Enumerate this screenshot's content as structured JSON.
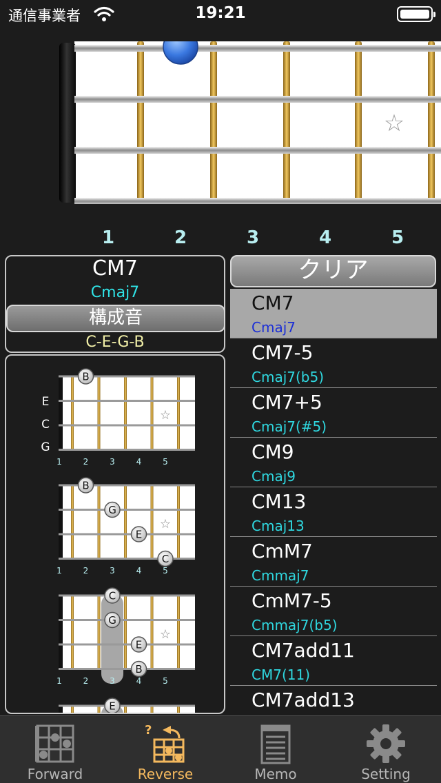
{
  "status": {
    "carrier": "通信事業者",
    "time": "19:21"
  },
  "fretboard": {
    "fret_numbers": [
      "1",
      "2",
      "3",
      "4",
      "5"
    ],
    "star_glyph": "☆"
  },
  "info": {
    "name": "CM7",
    "alt": "Cmaj7",
    "button_label": "構成音",
    "notes": "C-E-G-B"
  },
  "clear_label": "クリア",
  "diagrams": {
    "string_labels": [
      "E",
      "C",
      "G"
    ],
    "fret_numbers": [
      "1",
      "2",
      "3",
      "4",
      "5"
    ],
    "items": [
      {
        "dots": [
          {
            "n": "B",
            "fret": 2,
            "string": 0
          }
        ]
      },
      {
        "dots": [
          {
            "n": "B",
            "fret": 2,
            "string": 0
          },
          {
            "n": "G",
            "fret": 3,
            "string": 1
          },
          {
            "n": "E",
            "fret": 4,
            "string": 2
          },
          {
            "n": "C",
            "fret": 5,
            "string": 3
          }
        ]
      },
      {
        "dots": [
          {
            "n": "C",
            "fret": 3,
            "string": 0
          },
          {
            "n": "G",
            "fret": 3,
            "string": 1
          },
          {
            "n": "E",
            "fret": 4,
            "string": 2
          },
          {
            "n": "B",
            "fret": 4,
            "string": 3
          }
        ],
        "barre_fret": 3
      },
      {
        "dots": [
          {
            "n": "E",
            "fret": 3,
            "string": 0
          }
        ],
        "barre_fret": 3
      }
    ]
  },
  "chords": [
    {
      "name": "CM7",
      "alt": "Cmaj7",
      "selected": true
    },
    {
      "name": "CM7-5",
      "alt": "Cmaj7(b5)"
    },
    {
      "name": "CM7+5",
      "alt": "Cmaj7(#5)"
    },
    {
      "name": "CM9",
      "alt": "Cmaj9"
    },
    {
      "name": "CM13",
      "alt": "Cmaj13"
    },
    {
      "name": "CmM7",
      "alt": "Cmmaj7"
    },
    {
      "name": "CmM7-5",
      "alt": "Cmmaj7(b5)"
    },
    {
      "name": "CM7add11",
      "alt": "CM7(11)"
    },
    {
      "name": "CM7add13",
      "alt": ""
    }
  ],
  "tabs": [
    {
      "label": "Forward",
      "icon": "chord-grid-icon"
    },
    {
      "label": "Reverse",
      "icon": "reverse-chord-icon",
      "active": true
    },
    {
      "label": "Memo",
      "icon": "notepad-icon"
    },
    {
      "label": "Setting",
      "icon": "gear-icon"
    }
  ],
  "colors": {
    "background": "#1c1c1c",
    "fret_gold": "#d4a23c",
    "alt_cyan": "#2fe3e6",
    "notes_yellow": "#f2f0a8",
    "active_tab": "#f4b95e",
    "selected_row": "#a8a8a8",
    "selected_alt": "#1c2fd6"
  }
}
